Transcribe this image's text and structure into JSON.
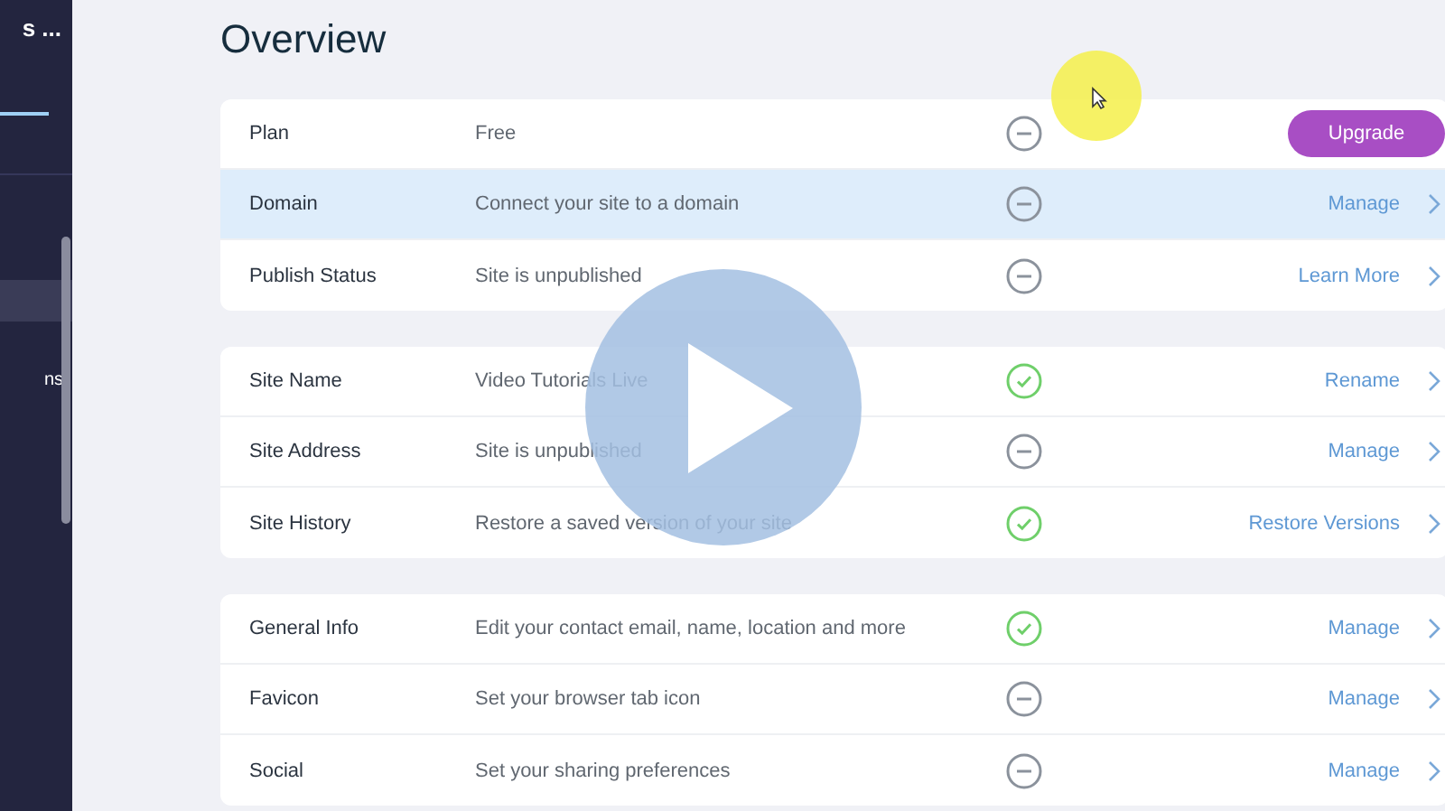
{
  "sidebar": {
    "title": "s ...",
    "items": [
      {
        "selected": true
      },
      {
        "label": "ns",
        "selected": false
      }
    ]
  },
  "page_title": "Overview",
  "sections": [
    {
      "rows": [
        {
          "label": "Plan",
          "value": "Free",
          "done": false,
          "action": {
            "kind": "button",
            "label": "Upgrade"
          },
          "selected": false
        },
        {
          "label": "Domain",
          "value": "Connect your site to a domain",
          "done": false,
          "action": {
            "kind": "link",
            "label": "Manage"
          },
          "selected": true
        },
        {
          "label": "Publish Status",
          "value": "Site is unpublished",
          "done": false,
          "action": {
            "kind": "link",
            "label": "Learn More"
          },
          "selected": false
        }
      ]
    },
    {
      "rows": [
        {
          "label": "Site Name",
          "value": "Video Tutorials Live",
          "done": true,
          "action": {
            "kind": "link",
            "label": "Rename"
          },
          "selected": false
        },
        {
          "label": "Site Address",
          "value": "Site is unpublished",
          "done": false,
          "action": {
            "kind": "link",
            "label": "Manage"
          },
          "selected": false
        },
        {
          "label": "Site History",
          "value": "Restore a saved version of your site",
          "done": true,
          "action": {
            "kind": "link",
            "label": "Restore Versions"
          },
          "selected": false
        }
      ]
    },
    {
      "rows": [
        {
          "label": "General Info",
          "value": "Edit your contact email, name, location and more",
          "done": true,
          "action": {
            "kind": "link",
            "label": "Manage"
          },
          "selected": false
        },
        {
          "label": "Favicon",
          "value": "Set your browser tab icon",
          "done": false,
          "action": {
            "kind": "link",
            "label": "Manage"
          },
          "selected": false
        },
        {
          "label": "Social",
          "value": "Set your sharing preferences",
          "done": false,
          "action": {
            "kind": "link",
            "label": "Manage"
          },
          "selected": false
        }
      ]
    }
  ]
}
